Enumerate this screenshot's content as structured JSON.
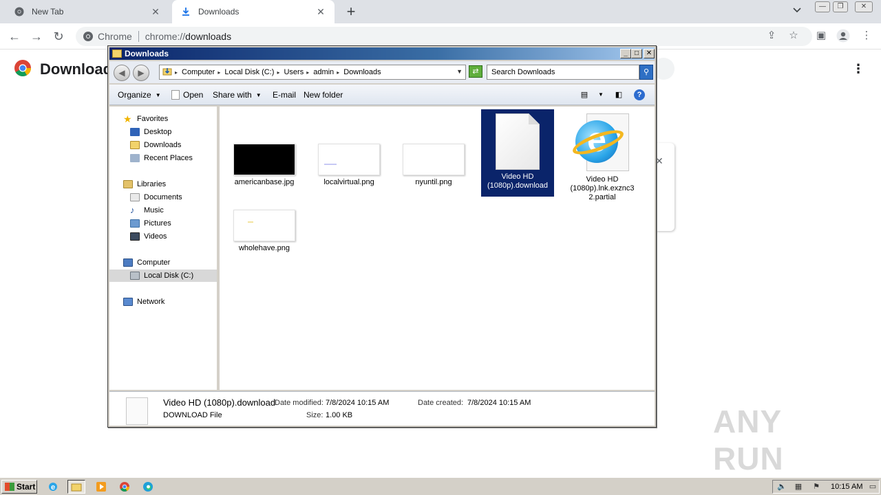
{
  "browser": {
    "tabs": [
      {
        "label": "New Tab"
      },
      {
        "label": "Downloads"
      }
    ],
    "new_tab": "+",
    "omnibox": {
      "chip": "Chrome",
      "scheme": "chrome://",
      "host": "downloads"
    },
    "page_title": "Downloads"
  },
  "explorer": {
    "title": "Downloads",
    "breadcrumb": [
      "Computer",
      "Local Disk (C:)",
      "Users",
      "admin",
      "Downloads"
    ],
    "search_placeholder": "Search Downloads",
    "commands": {
      "organize": "Organize",
      "open": "Open",
      "share": "Share with",
      "email": "E-mail",
      "new_folder": "New folder"
    },
    "nav": {
      "favorites": "Favorites",
      "desktop": "Desktop",
      "downloads": "Downloads",
      "recent": "Recent Places",
      "libraries": "Libraries",
      "documents": "Documents",
      "music": "Music",
      "pictures": "Pictures",
      "videos": "Videos",
      "computer": "Computer",
      "local_disk": "Local Disk (C:)",
      "network": "Network"
    },
    "files": [
      {
        "name": "americanbase.jpg"
      },
      {
        "name": "localvirtual.png"
      },
      {
        "name": "nyuntil.png"
      },
      {
        "name": "Video HD (1080p).download",
        "line1": "Video HD",
        "line2": "(1080p).download"
      },
      {
        "name": "Video HD (1080p).lnk.exznc32.partial",
        "line1": "Video HD",
        "line2": "(1080p).lnk.exznc3",
        "line3": "2.partial"
      },
      {
        "name": "wholehave.png"
      }
    ],
    "details": {
      "name": "Video HD (1080p).download",
      "type": "DOWNLOAD File",
      "modified_label": "Date modified:",
      "modified": "7/8/2024 10:15 AM",
      "size_label": "Size:",
      "size": "1.00 KB",
      "created_label": "Date created:",
      "created": "7/8/2024 10:15 AM"
    }
  },
  "taskbar": {
    "start": "Start",
    "clock": "10:15 AM"
  },
  "watermark": "ANY RUN"
}
